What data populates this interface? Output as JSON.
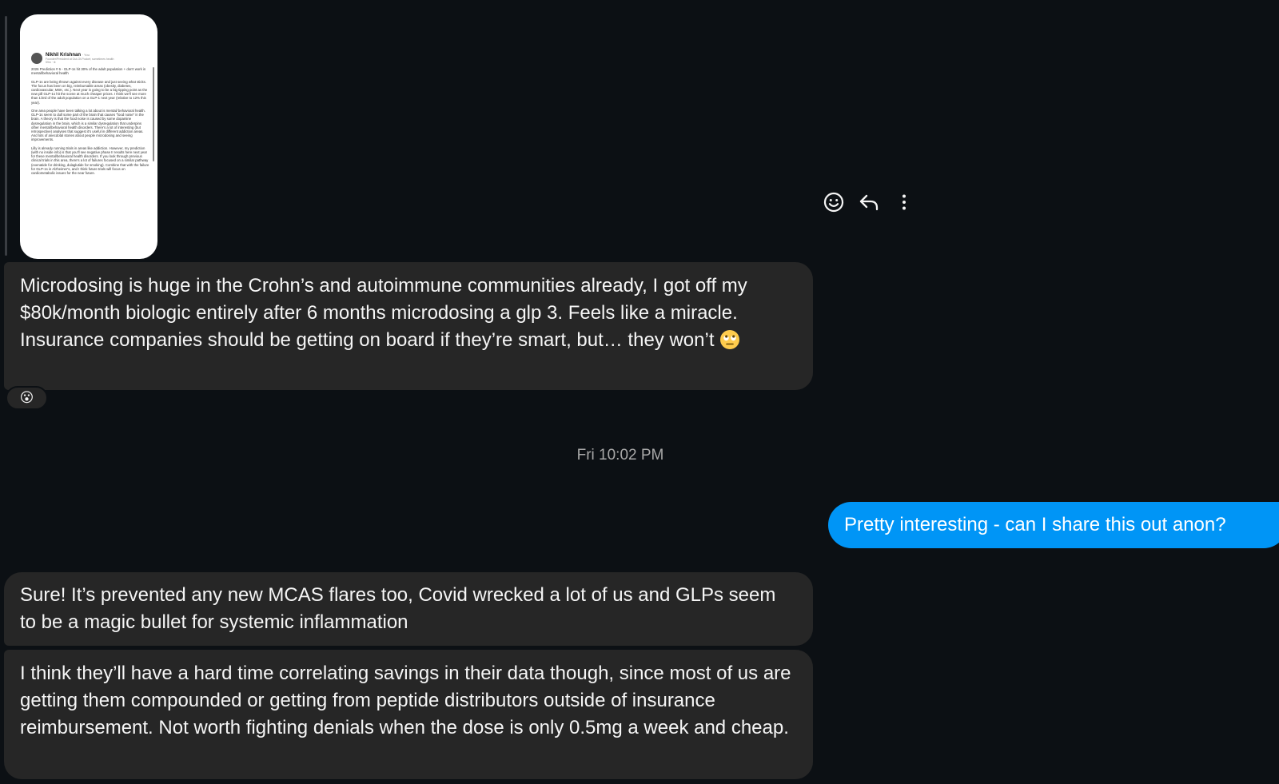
{
  "shared_post": {
    "author": "Nikhil Krishnan",
    "author_meta": "· You",
    "headline": "Founder/President at Out-Of-Pocket; sometimes health",
    "age": "59m · ⊕",
    "body": "2026 Prediction # 6 - GLP-1s hit 30% of the adult population + don't work in mental/behavioral health\n\nGLP-1s are being thrown against every disease and just seeing what sticks. The focus has been on big, reimbursable areas (obesity, diabetes, cardiovascular, MSK, etc.). Next year is going to be a big tipping point as the new pill GLP-1s hit the scene at much cheaper prices. I think we'll see more than 1/3rd of the adult population on a GLP-1 next year (relative to 12% this year).\n\nOne area people have been talking a lot about is mental/ behavioral health. GLP-1s seem to dull some part of the brain that causes \"food noise\" in the brain. A theory is that the food noise is caused by some dopamine dysregulation in the brain, which is a similar dysregulation that underpins other mental/behavioral health disorders. There's a lot of interesting (but retrospective) analyses that suggest it's useful in different addiction areas. And lots of anecdotal stories about people microdosing and seeing improvements.\n\nLilly is already running trials in areas like addiction. However, my prediction (with no inside info) is that you'll see negative phase II results here next year for these mental/behavioral health disorders. If you look through previous clinical trials in this area, there's a lot of failures focused on a similar pathway (exenatide for drinking, dulaglutide for smoking). Combine that with the failure for GLP-1s in Alzheimer's, and I think future trials will focus on cardiometabolic issues for the near future."
  },
  "message_actions": {
    "react_icon": "smiley-icon",
    "reply_icon": "reply-arrow-icon",
    "more_icon": "vertical-ellipsis-icon"
  },
  "messages": [
    {
      "direction": "incoming",
      "text": "Microdosing is huge in the Crohn’s and autoimmune communities already, I got off my $80k/month biologic entirely after 6 months microdosing a glp 3. Feels like a miracle. Insurance companies should be getting on board if they’re smart, but… they won’t",
      "trailing_emoji": "🙄",
      "reaction": "😮"
    },
    {
      "direction": "outgoing",
      "text": "Pretty interesting - can I share this out anon?"
    },
    {
      "direction": "incoming",
      "text": "Sure! It’s prevented any new MCAS flares too, Covid wrecked a lot of us and GLPs seem to be a magic bullet for systemic inflammation"
    },
    {
      "direction": "incoming",
      "text": "I think they’ll have a hard time correlating savings in their data though, since most of us are getting them compounded or getting from peptide distributors outside of insurance reimbursement. Not worth fighting denials when the dose is only 0.5mg a week and cheap."
    }
  ],
  "timestamp": "Fri 10:02 PM",
  "colors": {
    "background": "#0c1014",
    "incoming_bubble": "#262626",
    "outgoing_bubble": "#0095f6",
    "timestamp_text": "#a8a8a8"
  }
}
